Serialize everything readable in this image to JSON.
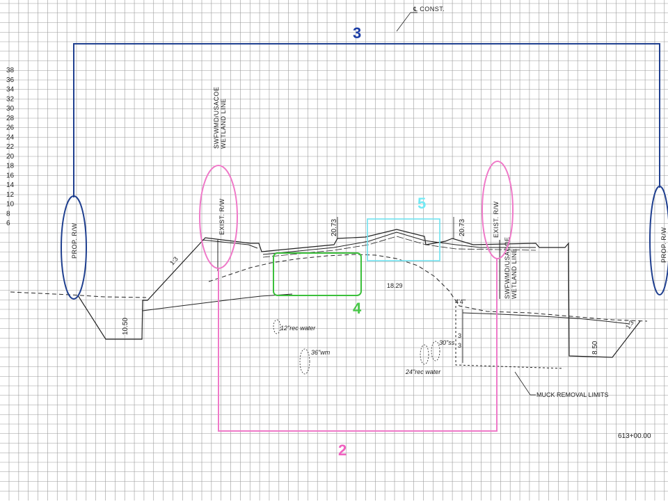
{
  "sheet": {
    "centerline_label": "℄ CONST.",
    "station": "613+00.00",
    "elevations": [
      "38",
      "36",
      "34",
      "32",
      "30",
      "28",
      "26",
      "24",
      "22",
      "20",
      "18",
      "16",
      "14",
      "12",
      "10",
      "8",
      "6"
    ],
    "prop_rw_label": "PROP. R/W",
    "exist_rw_label": "EXIST. R/W",
    "wetland_label_1": "SWFWMD/USACOE",
    "wetland_label_2": "WETLAND LINE",
    "slope_label": "1:3",
    "dim_left": "10.50",
    "dim_right": "8.50",
    "width_dim": "20.73",
    "depth_label": "18.29",
    "pipe_12": "12\"rec water",
    "pipe_36": "36\"wm",
    "pipe_30": "30\"ss",
    "pipe_24": "24\"rec water",
    "depth_4": "4'4\"",
    "tick_3a": "3",
    "tick_3b": "3",
    "muck_label": "MUCK REMOVAL LIMITS"
  },
  "markers": {
    "m2": "2",
    "m3": "3",
    "m4": "4",
    "m5": "5"
  },
  "colors": {
    "navy": "#1f3f8f",
    "pink": "#ef79c8",
    "green": "#3bbf3b",
    "cyan": "#6fe3f0",
    "grid": "#9a9a9a",
    "ink": "#222222",
    "marker_blue": "#1d3ea6",
    "marker_pink": "#f062c0",
    "marker_green": "#49c849",
    "marker_cyan": "#73eaf5"
  }
}
